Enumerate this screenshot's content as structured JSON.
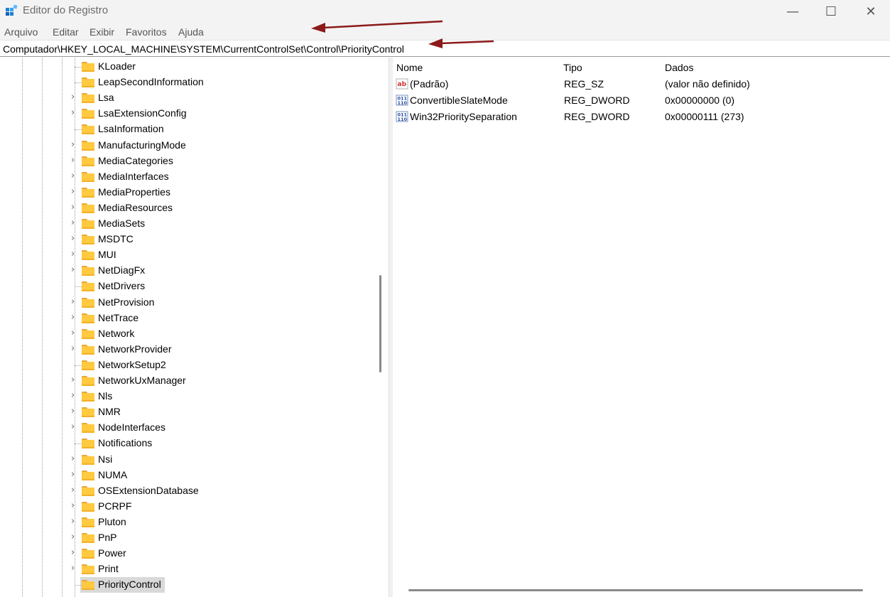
{
  "window": {
    "title": "Editor do Registro",
    "minimize_glyph": "—",
    "maximize_glyph": "☐",
    "close_glyph": "✕"
  },
  "menu": {
    "items": [
      "Arquivo",
      "Editar",
      "Exibir",
      "Favoritos",
      "Ajuda"
    ]
  },
  "address": {
    "path": "Computador\\HKEY_LOCAL_MACHINE\\SYSTEM\\CurrentControlSet\\Control\\PriorityControl"
  },
  "tree": {
    "items": [
      {
        "label": "KLoader",
        "expandable": false
      },
      {
        "label": "LeapSecondInformation",
        "expandable": false
      },
      {
        "label": "Lsa",
        "expandable": true
      },
      {
        "label": "LsaExtensionConfig",
        "expandable": true
      },
      {
        "label": "LsaInformation",
        "expandable": false
      },
      {
        "label": "ManufacturingMode",
        "expandable": true
      },
      {
        "label": "MediaCategories",
        "expandable": true
      },
      {
        "label": "MediaInterfaces",
        "expandable": true
      },
      {
        "label": "MediaProperties",
        "expandable": true
      },
      {
        "label": "MediaResources",
        "expandable": true
      },
      {
        "label": "MediaSets",
        "expandable": true
      },
      {
        "label": "MSDTC",
        "expandable": true
      },
      {
        "label": "MUI",
        "expandable": true
      },
      {
        "label": "NetDiagFx",
        "expandable": true
      },
      {
        "label": "NetDrivers",
        "expandable": false
      },
      {
        "label": "NetProvision",
        "expandable": true
      },
      {
        "label": "NetTrace",
        "expandable": true
      },
      {
        "label": "Network",
        "expandable": true
      },
      {
        "label": "NetworkProvider",
        "expandable": true
      },
      {
        "label": "NetworkSetup2",
        "expandable": false
      },
      {
        "label": "NetworkUxManager",
        "expandable": true
      },
      {
        "label": "Nls",
        "expandable": true
      },
      {
        "label": "NMR",
        "expandable": true
      },
      {
        "label": "NodeInterfaces",
        "expandable": true
      },
      {
        "label": "Notifications",
        "expandable": false
      },
      {
        "label": "Nsi",
        "expandable": true
      },
      {
        "label": "NUMA",
        "expandable": true
      },
      {
        "label": "OSExtensionDatabase",
        "expandable": true
      },
      {
        "label": "PCRPF",
        "expandable": true
      },
      {
        "label": "Pluton",
        "expandable": true
      },
      {
        "label": "PnP",
        "expandable": true
      },
      {
        "label": "Power",
        "expandable": true
      },
      {
        "label": "Print",
        "expandable": true
      },
      {
        "label": "PriorityControl",
        "expandable": false,
        "selected": true
      }
    ]
  },
  "values": {
    "columns": {
      "name": "Nome",
      "type": "Tipo",
      "data": "Dados"
    },
    "rows": [
      {
        "icon": "string-value-icon",
        "name": "(Padrão)",
        "type": "REG_SZ",
        "data": "(valor não definido)"
      },
      {
        "icon": "binary-value-icon",
        "name": "ConvertibleSlateMode",
        "type": "REG_DWORD",
        "data": "0x00000000 (0)"
      },
      {
        "icon": "binary-value-icon",
        "name": "Win32PrioritySeparation",
        "type": "REG_DWORD",
        "data": "0x00000111 (273)"
      }
    ]
  },
  "colors": {
    "annotation_arrow": "#8b1a1a",
    "folder": "#ffc940",
    "selection": "#d9d9d9"
  }
}
